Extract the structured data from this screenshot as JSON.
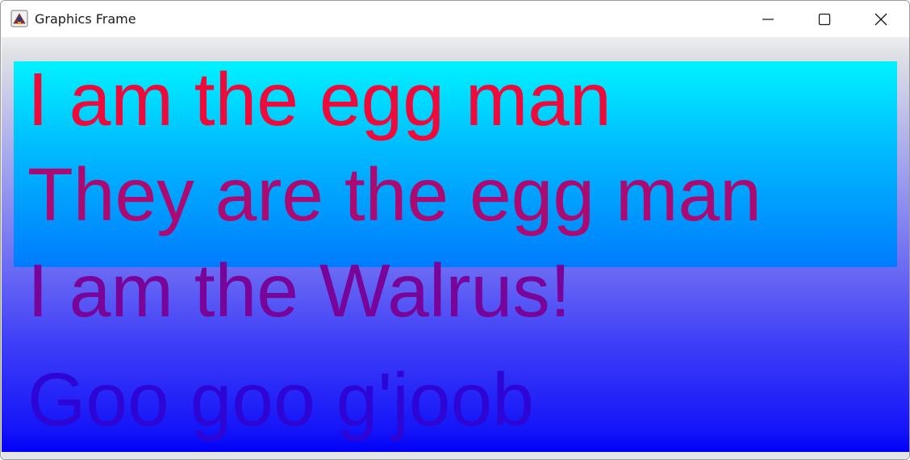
{
  "window": {
    "title": "Graphics Frame",
    "icon": "java-app-icon",
    "controls": {
      "minimize_icon": "minimize-icon",
      "maximize_icon": "maximize-icon",
      "close_icon": "close-icon"
    }
  },
  "canvas": {
    "lines": [
      "I am the egg man",
      "They are the egg man",
      "I am the Walrus!",
      "Goo goo g'joob"
    ],
    "colors": {
      "line1": "#ec0b3a",
      "line2": "#aa0a72",
      "line3": "#78049a",
      "line4": "#2d06d6",
      "rect_top": "#00f2ff",
      "rect_bottom": "#007cfd",
      "background_bottom": "#0000f8"
    }
  }
}
